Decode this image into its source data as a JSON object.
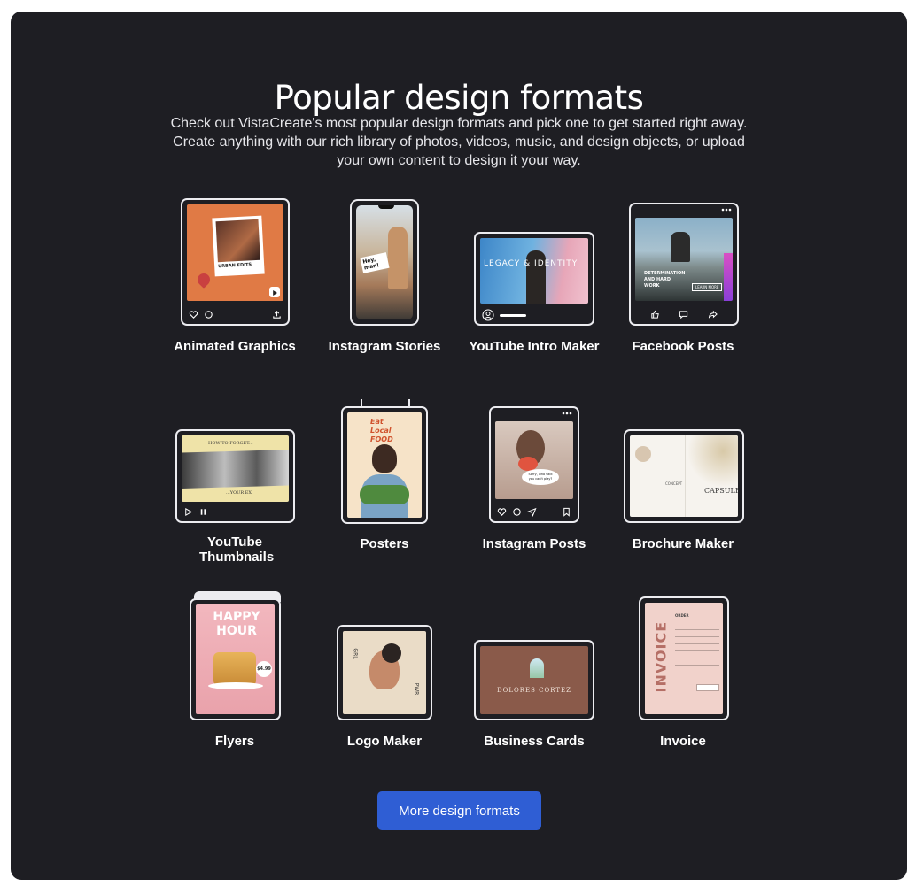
{
  "header": {
    "title": "Popular design formats",
    "subtitle": "Check out VistaCreate's most popular design formats and pick one to get started right away. Create anything with our rich library of photos, videos, music, and design objects, or upload your own content to design it your way."
  },
  "formats": [
    {
      "label": "Animated Graphics",
      "art_text": "URBAN EDITS"
    },
    {
      "label": "Instagram Stories",
      "art_text": "Hey, man!"
    },
    {
      "label": "YouTube Intro Maker",
      "art_text": "LEGACY & IDENTITY"
    },
    {
      "label": "Facebook Posts",
      "art_text": "DETERMINATION AND HARD WORK",
      "art_text2": "LEARN MORE"
    },
    {
      "label": "YouTube Thumbnails",
      "art_text": "HOW TO FORGET...",
      "art_text2": "...YOUR EX"
    },
    {
      "label": "Posters",
      "art_text": "Eat Local FOOD"
    },
    {
      "label": "Instagram Posts",
      "art_text": "Sorry, who said you can't play?"
    },
    {
      "label": "Brochure Maker",
      "art_text": "CAPSULE",
      "art_text2": "CONCEPT"
    },
    {
      "label": "Flyers",
      "art_text": "HAPPY HOUR",
      "art_text2": "$4.99"
    },
    {
      "label": "Logo Maker",
      "art_text": "GRL",
      "art_text2": "PWR"
    },
    {
      "label": "Business Cards",
      "art_text": "DOLORES CORTEZ"
    },
    {
      "label": "Invoice",
      "art_text": "INVOICE",
      "art_text2": "ORDER"
    }
  ],
  "cta": {
    "label": "More design formats"
  },
  "colors": {
    "panel": "#1e1e23",
    "button": "#2f5ed4",
    "text": "#ffffff"
  }
}
